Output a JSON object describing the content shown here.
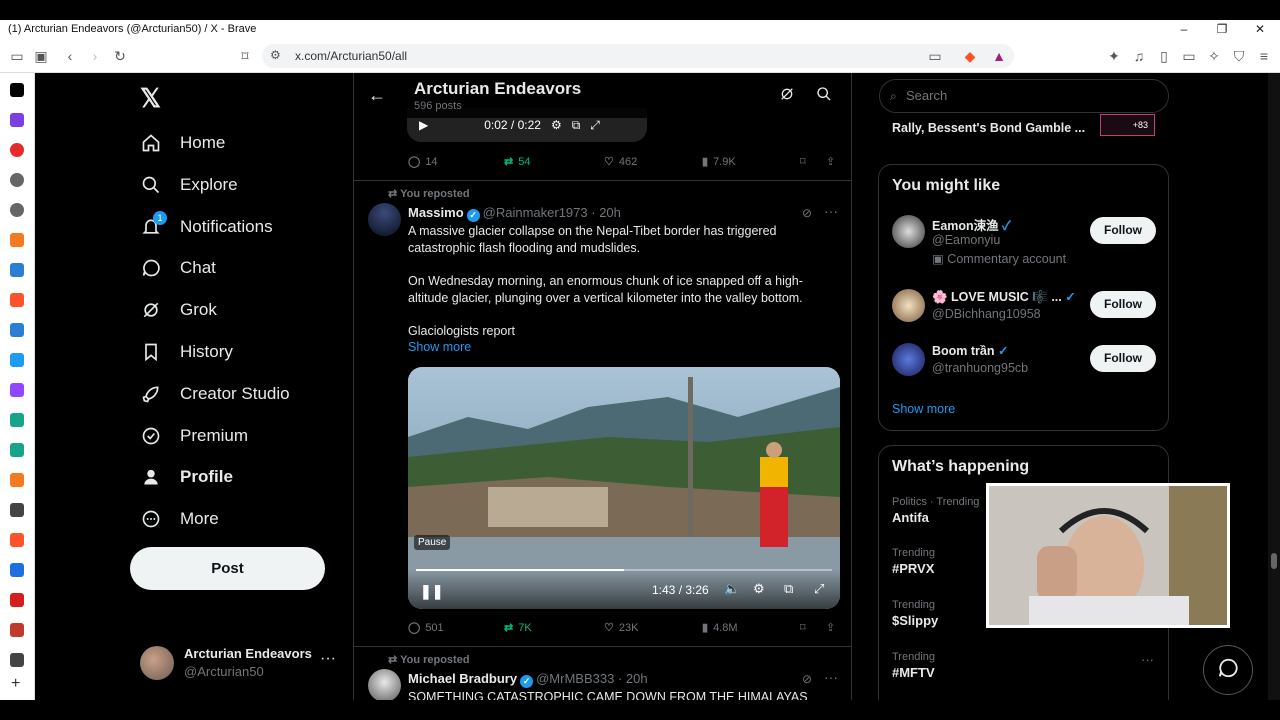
{
  "browser": {
    "window_title": "(1) Arcturian Endeavors (@Arcturian50) / X - Brave",
    "url": "x.com/Arcturian50/all"
  },
  "nav": {
    "items": [
      {
        "label": "Home",
        "icon": "home-icon"
      },
      {
        "label": "Explore",
        "icon": "search-icon"
      },
      {
        "label": "Notifications",
        "icon": "bell-icon",
        "badge": "1"
      },
      {
        "label": "Chat",
        "icon": "chat-icon"
      },
      {
        "label": "Grok",
        "icon": "grok-icon"
      },
      {
        "label": "History",
        "icon": "bookmark-icon"
      },
      {
        "label": "Creator Studio",
        "icon": "rocket-icon"
      },
      {
        "label": "Premium",
        "icon": "verified-icon"
      },
      {
        "label": "Profile",
        "icon": "person-icon"
      },
      {
        "label": "More",
        "icon": "more-circle-icon"
      }
    ],
    "post_label": "Post",
    "account": {
      "name": "Arcturian Endeavors",
      "handle": "@Arcturian50"
    }
  },
  "header": {
    "title": "Arcturian Endeavors",
    "subtitle": "596 posts"
  },
  "prev_post": {
    "video_time": "0:02 / 0:22",
    "replies": "14",
    "reposts": "54",
    "likes": "462",
    "views": "7.9K"
  },
  "post1": {
    "repost_label": "You reposted",
    "name": "Massimo",
    "handle": "@Rainmaker1973",
    "time": "· 20h",
    "p1": "A massive glacier collapse on the Nepal-Tibet border has triggered catastrophic flash flooding and mudslides.",
    "p2": "On Wednesday morning, an enormous chunk of ice snapped off a high-altitude glacier, plunging over a vertical kilometer into the valley bottom.",
    "p3": "Glaciologists report",
    "show_more": "Show more",
    "video_time": "1:43 / 3:26",
    "video_progress": 0.5,
    "pause_tip": "Pause",
    "replies": "501",
    "reposts": "7K",
    "likes": "23K",
    "views": "4.8M"
  },
  "post2": {
    "repost_label": "You reposted",
    "name": "Michael Bradbury",
    "handle": "@MrMBB333",
    "time": "· 20h",
    "text": "SOMETHING CATASTROPHIC CAME DOWN FROM THE HIMALAYAS"
  },
  "right": {
    "search_placeholder": "Search",
    "news_headline": "Rally, Bessent's Bond Gamble ...",
    "news_count": "+83",
    "wtf_title": "You might like",
    "wtf": [
      {
        "name": "Eamon涑渔",
        "handle": "@Eamonyiu",
        "extra": "Commentary account",
        "btn": "Follow"
      },
      {
        "name": "🌸 LOVE MUSIC 🎼 ...",
        "handle": "@DBichhang10958",
        "btn": "Follow"
      },
      {
        "name": "Boom trần",
        "handle": "@tranhuong95cb",
        "btn": "Follow"
      }
    ],
    "show_more": "Show more",
    "happening_title": "What’s happening",
    "trends": [
      {
        "cat": "Politics · Trending",
        "topic": "Antifa"
      },
      {
        "cat": "Trending",
        "topic": "#PRVX"
      },
      {
        "cat": "Trending",
        "topic": "$Slippy"
      },
      {
        "cat": "Trending",
        "topic": "#MFTV"
      }
    ]
  }
}
